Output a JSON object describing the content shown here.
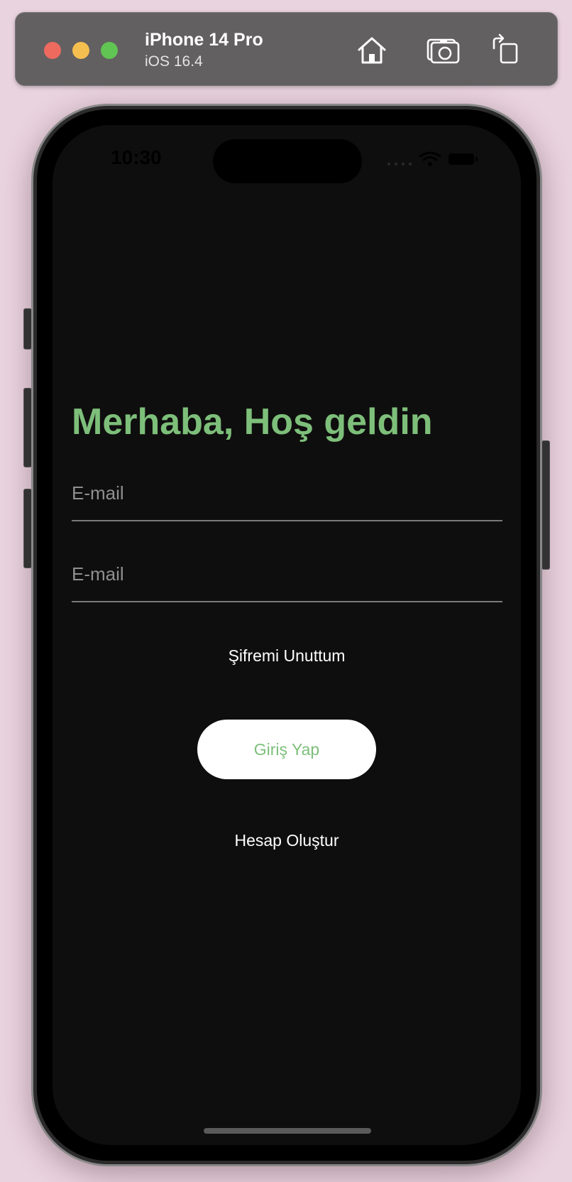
{
  "simulator": {
    "device_name": "iPhone 14 Pro",
    "os_version": "iOS 16.4",
    "icons": [
      "home-icon",
      "screenshot-icon",
      "rotate-icon"
    ]
  },
  "status_bar": {
    "time": "10:30",
    "icons": [
      "cellular-icon",
      "wifi-icon",
      "battery-icon"
    ]
  },
  "login": {
    "title": "Merhaba, Hoş geldin",
    "email_placeholder": "E-mail",
    "password_placeholder": "E-mail",
    "forgot_password": "Şifremi Unuttum",
    "login_button": "Giriş Yap",
    "create_account": "Hesap Oluştur"
  },
  "colors": {
    "accent_green": "#7dbf7a",
    "screen_background": "#0f0e0e",
    "button_background": "#ffffff"
  }
}
